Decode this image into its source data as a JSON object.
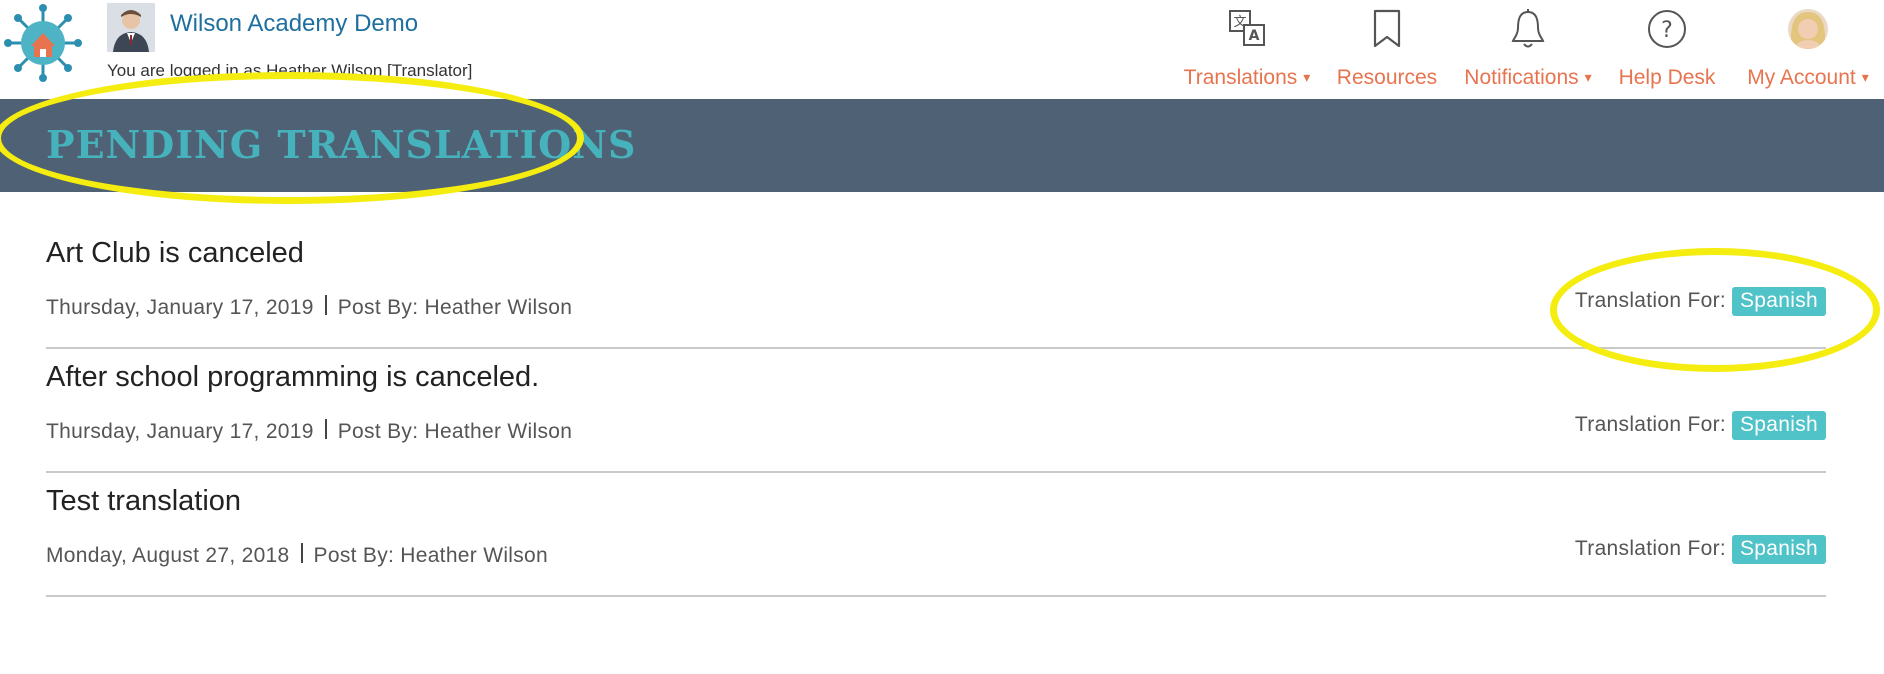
{
  "header": {
    "school_name": "Wilson Academy Demo",
    "login_status": "You are logged in as Heather Wilson [Translator]"
  },
  "nav": {
    "translations": {
      "label": "Translations",
      "caret": "▾",
      "icon": "translate-icon"
    },
    "resources": {
      "label": "Resources",
      "icon": "bookmark-icon"
    },
    "notifications": {
      "label": "Notifications",
      "caret": "▾",
      "icon": "bell-icon"
    },
    "help_desk": {
      "label": "Help Desk",
      "icon": "help-icon"
    },
    "my_account": {
      "label": "My Account",
      "caret": "▾",
      "icon": "avatar"
    }
  },
  "page": {
    "title": "PENDING TRANSLATIONS"
  },
  "translations": [
    {
      "title": "Art Club is canceled",
      "date": "Thursday, January 17, 2019",
      "post_by": "Post By: Heather Wilson",
      "translation_for_label": "Translation For:",
      "language": "Spanish"
    },
    {
      "title": "After school programming is canceled.",
      "date": "Thursday, January 17, 2019",
      "post_by": "Post By: Heather Wilson",
      "translation_for_label": "Translation For:",
      "language": "Spanish"
    },
    {
      "title": "Test translation",
      "date": "Monday, August 27, 2018",
      "post_by": "Post By: Heather Wilson",
      "translation_for_label": "Translation For:",
      "language": "Spanish"
    }
  ],
  "colors": {
    "accent": "#e8744f",
    "title_band": "#4e6175",
    "title_text": "#46b3bc",
    "badge": "#4fc3c8",
    "highlight": "#f5ec10",
    "link": "#1e6f9f"
  }
}
